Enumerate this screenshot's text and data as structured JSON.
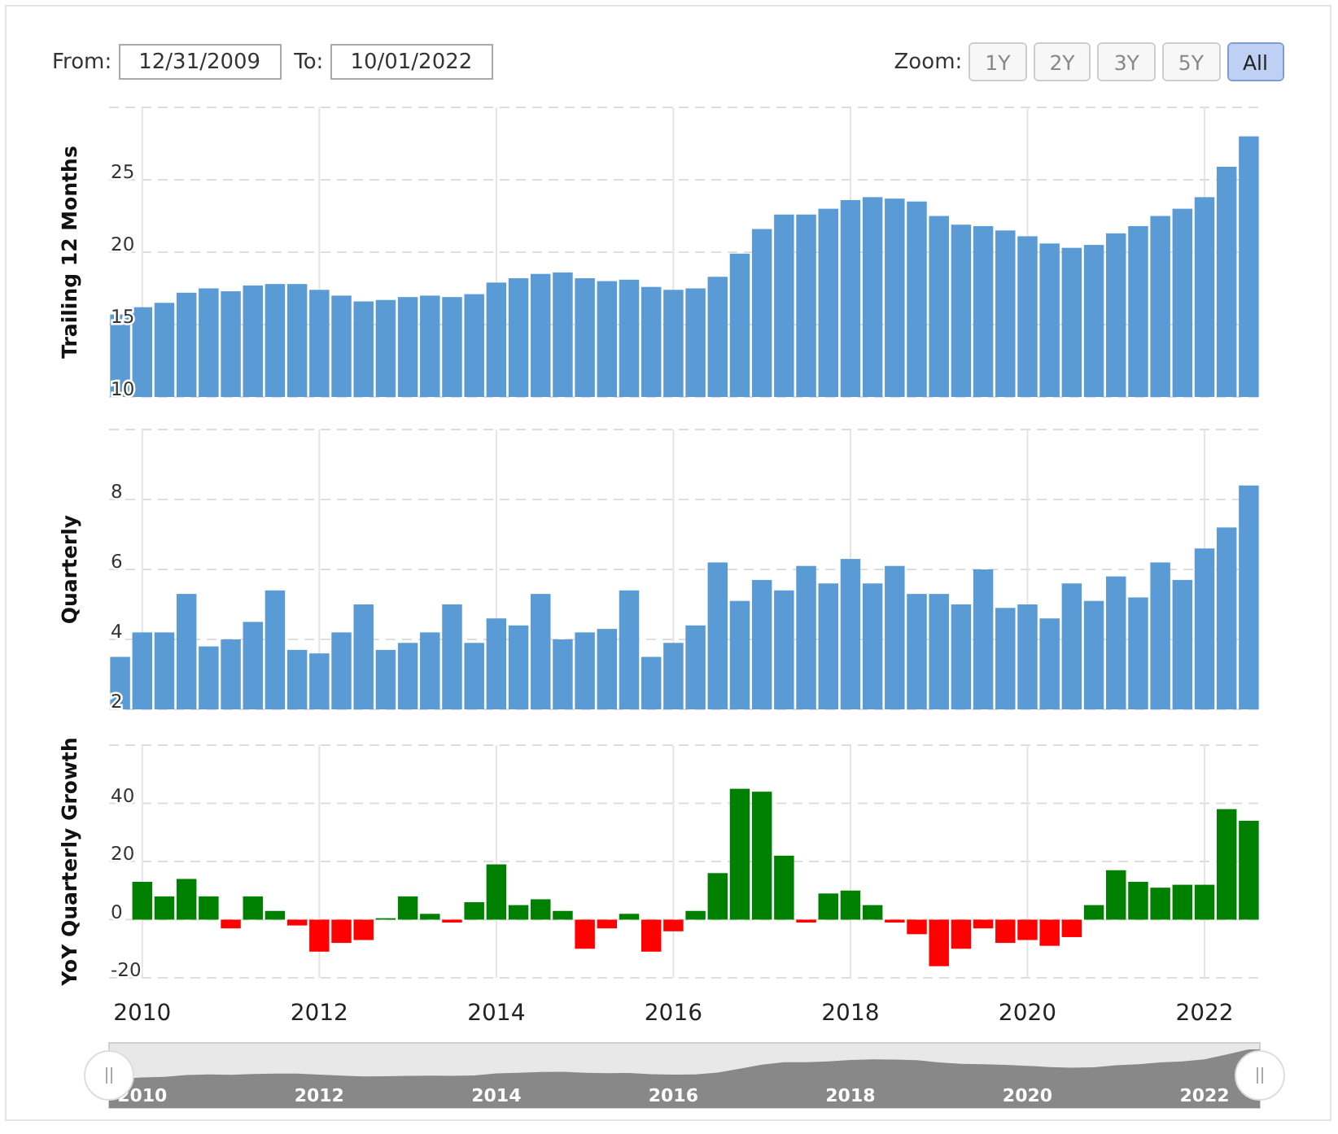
{
  "date_range": {
    "from_label": "From:",
    "from_value": "12/31/2009",
    "to_label": "To:",
    "to_value": "10/01/2022"
  },
  "zoom": {
    "label": "Zoom:",
    "buttons": [
      {
        "label": "1Y",
        "selected": false
      },
      {
        "label": "2Y",
        "selected": false
      },
      {
        "label": "3Y",
        "selected": false
      },
      {
        "label": "5Y",
        "selected": false
      },
      {
        "label": "All",
        "selected": true
      }
    ]
  },
  "charts": [
    {
      "chart_data": {
        "type": "bar",
        "ylabel": "Trailing 12 Months",
        "grid": true,
        "ylim": [
          10,
          30
        ],
        "yticks": [
          10,
          15,
          20,
          25
        ],
        "series": [
          {
            "color": "#5b9bd5",
            "values": [
              15.7,
              16.2,
              16.5,
              17.2,
              17.5,
              17.3,
              17.7,
              17.8,
              17.8,
              17.4,
              17.0,
              16.6,
              16.7,
              16.9,
              17.0,
              16.9,
              17.1,
              17.9,
              18.2,
              18.5,
              18.6,
              18.2,
              18.0,
              18.1,
              17.6,
              17.4,
              17.5,
              18.3,
              19.9,
              21.6,
              22.6,
              22.6,
              23.0,
              23.6,
              23.8,
              23.7,
              23.5,
              22.5,
              21.9,
              21.8,
              21.5,
              21.1,
              20.6,
              20.3,
              20.5,
              21.3,
              21.8,
              22.5,
              23.0,
              23.8,
              25.9,
              28.0
            ]
          }
        ]
      }
    },
    {
      "chart_data": {
        "type": "bar",
        "ylabel": "Quarterly",
        "grid": true,
        "ylim": [
          2,
          10
        ],
        "yticks": [
          2,
          4,
          6,
          8
        ],
        "series": [
          {
            "color": "#5b9bd5",
            "values": [
              3.5,
              4.2,
              4.2,
              5.3,
              3.8,
              4.0,
              4.5,
              5.4,
              3.7,
              3.6,
              4.2,
              5.0,
              3.7,
              3.9,
              4.2,
              5.0,
              3.9,
              4.6,
              4.4,
              5.3,
              4.0,
              4.2,
              4.3,
              5.4,
              3.5,
              3.9,
              4.4,
              6.2,
              5.1,
              5.7,
              5.4,
              6.1,
              5.6,
              6.3,
              5.6,
              6.1,
              5.3,
              5.3,
              5.0,
              6.0,
              4.9,
              5.0,
              4.6,
              5.6,
              5.1,
              5.8,
              5.2,
              6.2,
              5.7,
              6.6,
              7.2,
              8.4
            ]
          }
        ]
      }
    },
    {
      "x_labels": [
        "2010",
        "2012",
        "2014",
        "2016",
        "2018",
        "2020",
        "2022"
      ],
      "chart_data": {
        "type": "bar",
        "ylabel": "YoY Quarterly Growth",
        "grid": true,
        "ylim": [
          -20,
          60
        ],
        "yticks": [
          -20,
          0,
          20,
          40
        ],
        "stacked": true,
        "series": [
          {
            "color": "#008000",
            "values": [
              null,
              13,
              8,
              14,
              8,
              null,
              8,
              3,
              null,
              null,
              null,
              null,
              0.5,
              8,
              2,
              null,
              6,
              19,
              5,
              7,
              3,
              null,
              null,
              2,
              null,
              null,
              3,
              16,
              45,
              44,
              22,
              null,
              9,
              10,
              5,
              null,
              null,
              null,
              null,
              null,
              null,
              null,
              null,
              null,
              5,
              17,
              13,
              11,
              12,
              12,
              38,
              34
            ]
          },
          {
            "color": "#ff0000",
            "values": [
              null,
              null,
              null,
              null,
              null,
              -3,
              null,
              null,
              -2,
              -11,
              -8,
              -7,
              null,
              null,
              null,
              -1,
              null,
              null,
              null,
              null,
              null,
              -10,
              -3,
              null,
              -11,
              -4,
              null,
              null,
              null,
              null,
              null,
              -1,
              null,
              null,
              null,
              -1,
              -5,
              -16,
              -10,
              -3,
              -8,
              -7,
              -9,
              -6,
              null,
              null,
              null,
              null,
              null,
              null,
              null,
              null
            ]
          }
        ]
      }
    }
  ],
  "navigator": {
    "labels": [
      "2010",
      "2012",
      "2014",
      "2016",
      "2018",
      "2020",
      "2022"
    ]
  }
}
